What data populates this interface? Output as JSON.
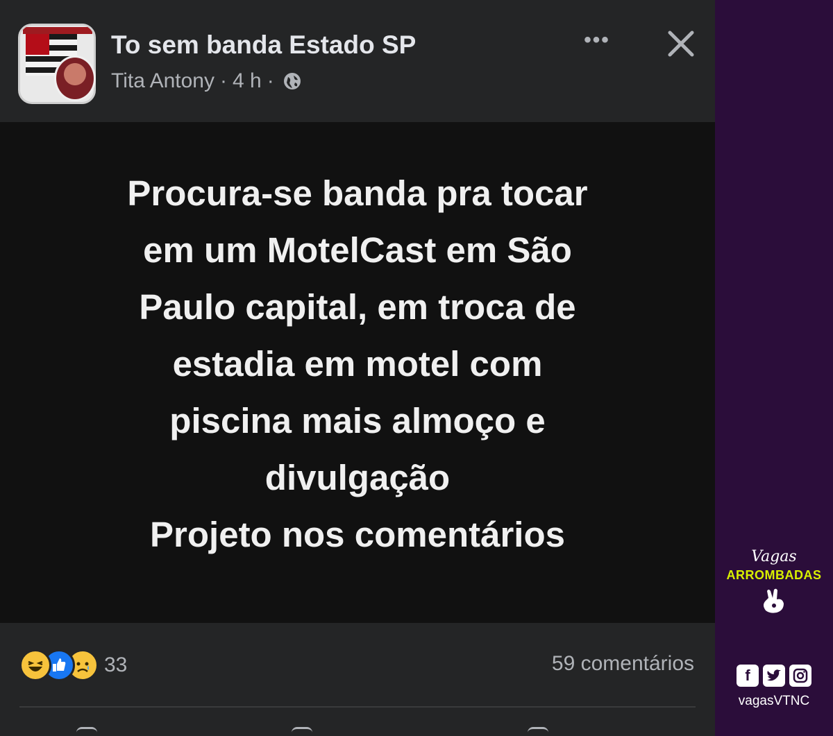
{
  "post": {
    "group_name": "To sem banda Estado SP",
    "author": "Tita Antony",
    "time": "4 h",
    "separator": "·",
    "more_label": "•••",
    "text": "Procura-se banda pra tocar\nem um MotelCast em São\nPaulo capital, em troca de\nestadia em motel com\npiscina mais almoço e\ndivulgação \nProjeto nos comentários",
    "reactions": [
      "haha-icon",
      "like-icon",
      "sad-icon"
    ],
    "reaction_count": "33",
    "comments_count": "59 comentários"
  },
  "colors": {
    "post_bg": "#242526",
    "content_bg": "#111111",
    "text_primary": "#e4e6eb",
    "text_secondary": "#b0b3b8",
    "sidebar_bg": "#2b0d3a",
    "brand_accent": "#d8f000"
  },
  "watermark": {
    "script": "Vagas",
    "bold": "ARROMBADAS",
    "handle": "vagasVTNC",
    "social_icons": [
      "facebook-icon",
      "twitter-icon",
      "instagram-icon"
    ]
  }
}
